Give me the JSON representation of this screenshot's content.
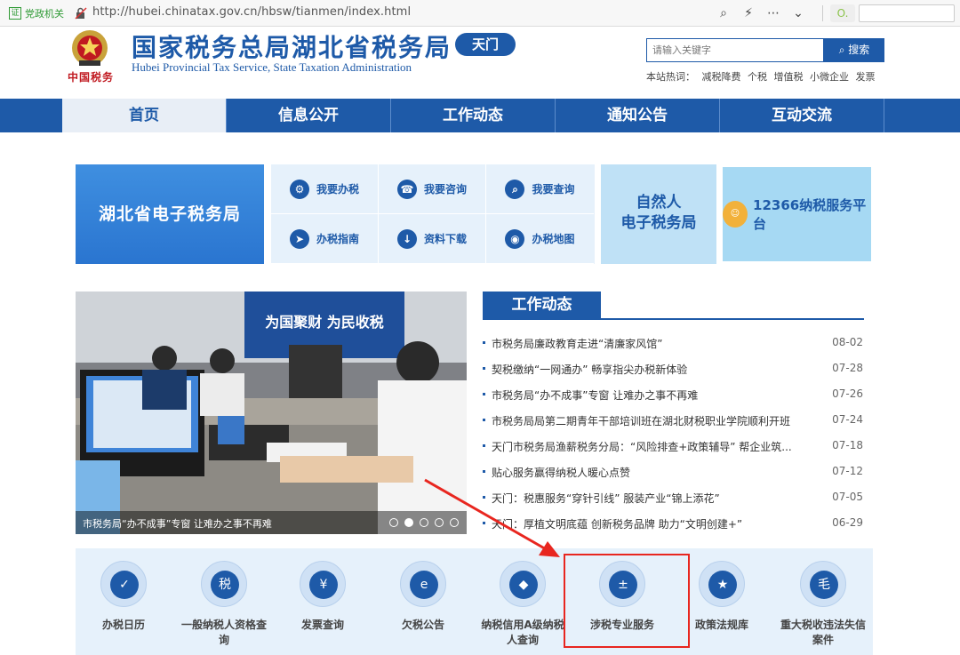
{
  "browser": {
    "badge": "党政机关",
    "badge_glyph": "证",
    "url": "http://hubei.chinatax.gov.cn/hbsw/tianmen/index.html"
  },
  "header": {
    "emblem_text": "中国税务",
    "title": "国家税务总局湖北省税务局",
    "subtitle": "Hubei Provincial Tax Service, State Taxation Administration",
    "city": "天门",
    "search_placeholder": "请输入关键字",
    "search_button": "搜索",
    "hot_label": "本站热词：",
    "hot_words": [
      "减税降费",
      "个税",
      "增值税",
      "小微企业",
      "发票"
    ]
  },
  "nav": [
    "首页",
    "信息公开",
    "工作动态",
    "通知公告",
    "互动交流"
  ],
  "banner": {
    "esb": "湖北省电子税务局",
    "quick": [
      "我要办税",
      "我要咨询",
      "我要查询",
      "办税指南",
      "资料下载",
      "办税地图"
    ],
    "natural_line1": "自然人",
    "natural_line2": "电子税务局",
    "svc12366": "12366纳税服务平台"
  },
  "slider": {
    "caption": "市税务局“办不成事”专窗 让难办之事不再难",
    "sign": "为国聚财 为民收税",
    "active_slide": 2,
    "slide_count": 5
  },
  "news": {
    "title": "工作动态",
    "items": [
      {
        "text": "市税务局廉政教育走进“清廉家风馆”",
        "date": "08-02"
      },
      {
        "text": "契税缴纳“一网通办” 畅享指尖办税新体验",
        "date": "07-28"
      },
      {
        "text": "市税务局“办不成事”专窗 让难办之事不再难",
        "date": "07-26"
      },
      {
        "text": "市税务局局第二期青年干部培训班在湖北财税职业学院顺利开班",
        "date": "07-24"
      },
      {
        "text": "天门市税务局渔薪税务分局：“风险排查+政策辅导” 帮企业筑...",
        "date": "07-18"
      },
      {
        "text": "贴心服务赢得纳税人暖心点赞",
        "date": "07-12"
      },
      {
        "text": "天门：税惠服务“穿针引线” 服装产业“锦上添花”",
        "date": "07-05"
      },
      {
        "text": "天门：厚植文明底蕴 创新税务品牌 助力“文明创建+”",
        "date": "06-29"
      }
    ]
  },
  "services": [
    {
      "label": "办税日历",
      "icon": "calendar-icon",
      "glyph": "✓"
    },
    {
      "label": "一般纳税人资格查询",
      "icon": "taxpayer-search-icon",
      "glyph": "税"
    },
    {
      "label": "发票查询",
      "icon": "invoice-icon",
      "glyph": "¥"
    },
    {
      "label": "欠税公告",
      "icon": "monitor-e-icon",
      "glyph": "e"
    },
    {
      "label": "纳税信用A级纳税人查询",
      "icon": "diamond-icon",
      "glyph": "◆"
    },
    {
      "label": "涉税专业服务",
      "icon": "calculator-icon",
      "glyph": "±"
    },
    {
      "label": "政策法规库",
      "icon": "book-icon",
      "glyph": "★"
    },
    {
      "label": "重大税收违法失信案件",
      "icon": "clipboard-icon",
      "glyph": "毛"
    }
  ],
  "colors": {
    "brand": "#1e5aa8",
    "highlight": "#e8261f",
    "panel": "#e6f1fb"
  }
}
